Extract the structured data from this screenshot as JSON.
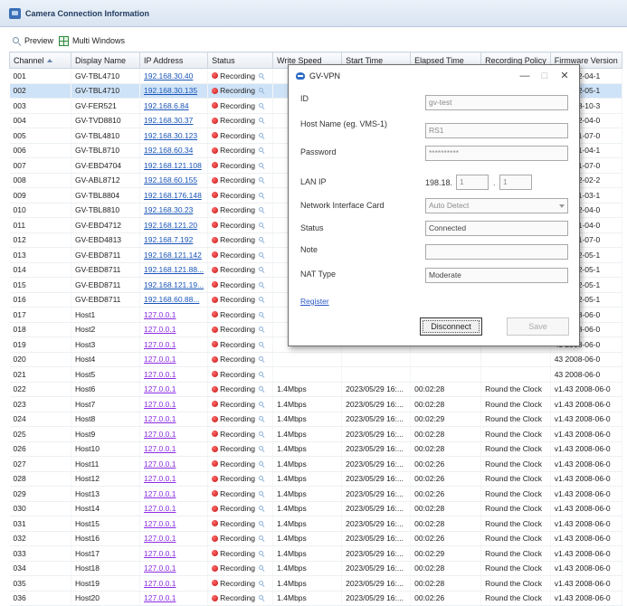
{
  "window": {
    "title": "Camera Connection Information",
    "accent": "#3a6fb7"
  },
  "toolbar": {
    "preview_label": "Preview",
    "multi_windows_label": "Multi Windows"
  },
  "table": {
    "columns": [
      "Channel",
      "Display Name",
      "IP Address",
      "Status",
      "Write Speed",
      "Start Time",
      "Elapsed Time",
      "Recording Policy",
      "Firmware Version"
    ],
    "rows": [
      {
        "ch": "001",
        "name": "GV-TBL4710",
        "ip": "192.168.30.40",
        "status": "Recording",
        "speed": "",
        "start": "",
        "elapsed": "",
        "policy": "",
        "fw": "05 2022-04-1"
      },
      {
        "ch": "002",
        "name": "GV-TBL4710",
        "ip": "192.168.30.135",
        "status": "Recording",
        "speed": "",
        "start": "",
        "elapsed": "",
        "policy": "",
        "fw": "07 2022-05-1"
      },
      {
        "ch": "003",
        "name": "GV-FER521",
        "ip": "192.168.6.84",
        "status": "Recording",
        "speed": "",
        "start": "",
        "elapsed": "",
        "policy": "",
        "fw": "17 2018-10-3"
      },
      {
        "ch": "004",
        "name": "GV-TVD8810",
        "ip": "192.168.30.37",
        "status": "Recording",
        "speed": "",
        "start": "",
        "elapsed": "",
        "policy": "",
        "fw": "05 2022-04-0"
      },
      {
        "ch": "005",
        "name": "GV-TBL4810",
        "ip": "192.168.30.123",
        "status": "Recording",
        "speed": "",
        "start": "",
        "elapsed": "",
        "policy": "",
        "fw": "00 2021-07-0"
      },
      {
        "ch": "006",
        "name": "GV-TBL8710",
        "ip": "192.168.60.34",
        "status": "Recording",
        "speed": "",
        "start": "",
        "elapsed": "",
        "policy": "",
        "fw": "04 2021-04-1"
      },
      {
        "ch": "007",
        "name": "GV-EBD4704",
        "ip": "192.168.121.108",
        "status": "Recording",
        "speed": "",
        "start": "",
        "elapsed": "",
        "policy": "",
        "fw": "00 2021-07-0"
      },
      {
        "ch": "008",
        "name": "GV-ABL8712",
        "ip": "192.168.60.155",
        "status": "Recording",
        "speed": "",
        "start": "",
        "elapsed": "",
        "policy": "",
        "fw": "05 2022-02-2"
      },
      {
        "ch": "009",
        "name": "GV-TBL8804",
        "ip": "192.168.176.148",
        "status": "Recording",
        "speed": "",
        "start": "",
        "elapsed": "",
        "policy": "",
        "fw": "01 2021-03-1"
      },
      {
        "ch": "010",
        "name": "GV-TBL8810",
        "ip": "192.168.30.23",
        "status": "Recording",
        "speed": "",
        "start": "",
        "elapsed": "",
        "policy": "",
        "fw": "05 2022-04-0"
      },
      {
        "ch": "011",
        "name": "GV-EBD4712",
        "ip": "192.168.121.20",
        "status": "Recording",
        "speed": "",
        "start": "",
        "elapsed": "",
        "policy": "",
        "fw": "02 2021-04-0"
      },
      {
        "ch": "012",
        "name": "GV-EBD4813",
        "ip": "192.168.7.192",
        "status": "Recording",
        "speed": "",
        "start": "",
        "elapsed": "",
        "policy": "",
        "fw": "00 2021-07-0"
      },
      {
        "ch": "013",
        "name": "GV-EBD8711",
        "ip": "192.168.121.142",
        "status": "Recording",
        "speed": "",
        "start": "",
        "elapsed": "",
        "policy": "",
        "fw": "06 2022-05-1"
      },
      {
        "ch": "014",
        "name": "GV-EBD8711",
        "ip": "192.168.121.88...",
        "status": "Recording",
        "speed": "",
        "start": "",
        "elapsed": "",
        "policy": "",
        "fw": "06 2022-05-1"
      },
      {
        "ch": "015",
        "name": "GV-EBD8711",
        "ip": "192.168.121.19...",
        "status": "Recording",
        "speed": "",
        "start": "",
        "elapsed": "",
        "policy": "",
        "fw": "06 2022-05-1"
      },
      {
        "ch": "016",
        "name": "GV-EBD8711",
        "ip": "192.168.60.88...",
        "status": "Recording",
        "speed": "",
        "start": "",
        "elapsed": "",
        "policy": "",
        "fw": "06 2022-05-1"
      },
      {
        "ch": "017",
        "name": "Host1",
        "ip": "127.0.0.1",
        "status": "Recording",
        "speed": "",
        "start": "",
        "elapsed": "",
        "policy": "",
        "fw": "43 2008-06-0"
      },
      {
        "ch": "018",
        "name": "Host2",
        "ip": "127.0.0.1",
        "status": "Recording",
        "speed": "",
        "start": "",
        "elapsed": "",
        "policy": "",
        "fw": "43 2008-06-0"
      },
      {
        "ch": "019",
        "name": "Host3",
        "ip": "127.0.0.1",
        "status": "Recording",
        "speed": "",
        "start": "",
        "elapsed": "",
        "policy": "",
        "fw": "43 2008-06-0"
      },
      {
        "ch": "020",
        "name": "Host4",
        "ip": "127.0.0.1",
        "status": "Recording",
        "speed": "",
        "start": "",
        "elapsed": "",
        "policy": "",
        "fw": "43 2008-06-0"
      },
      {
        "ch": "021",
        "name": "Host5",
        "ip": "127.0.0.1",
        "status": "Recording",
        "speed": "",
        "start": "",
        "elapsed": "",
        "policy": "",
        "fw": "43 2008-06-0"
      },
      {
        "ch": "022",
        "name": "Host6",
        "ip": "127.0.0.1",
        "status": "Recording",
        "speed": "1.4Mbps",
        "start": "2023/05/29 16:...",
        "elapsed": "00:02:28",
        "policy": "Round the Clock",
        "fw": "v1.43 2008-06-0"
      },
      {
        "ch": "023",
        "name": "Host7",
        "ip": "127.0.0.1",
        "status": "Recording",
        "speed": "1.4Mbps",
        "start": "2023/05/29 16:...",
        "elapsed": "00:02:28",
        "policy": "Round the Clock",
        "fw": "v1.43 2008-06-0"
      },
      {
        "ch": "024",
        "name": "Host8",
        "ip": "127.0.0.1",
        "status": "Recording",
        "speed": "1.4Mbps",
        "start": "2023/05/29 16:...",
        "elapsed": "00:02:29",
        "policy": "Round the Clock",
        "fw": "v1.43 2008-06-0"
      },
      {
        "ch": "025",
        "name": "Host9",
        "ip": "127.0.0.1",
        "status": "Recording",
        "speed": "1.4Mbps",
        "start": "2023/05/29 16:...",
        "elapsed": "00:02:28",
        "policy": "Round the Clock",
        "fw": "v1.43 2008-06-0"
      },
      {
        "ch": "026",
        "name": "Host10",
        "ip": "127.0.0.1",
        "status": "Recording",
        "speed": "1.4Mbps",
        "start": "2023/05/29 16:...",
        "elapsed": "00:02:28",
        "policy": "Round the Clock",
        "fw": "v1.43 2008-06-0"
      },
      {
        "ch": "027",
        "name": "Host11",
        "ip": "127.0.0.1",
        "status": "Recording",
        "speed": "1.4Mbps",
        "start": "2023/05/29 16:...",
        "elapsed": "00:02:26",
        "policy": "Round the Clock",
        "fw": "v1.43 2008-06-0"
      },
      {
        "ch": "028",
        "name": "Host12",
        "ip": "127.0.0.1",
        "status": "Recording",
        "speed": "1.4Mbps",
        "start": "2023/05/29 16:...",
        "elapsed": "00:02:26",
        "policy": "Round the Clock",
        "fw": "v1.43 2008-06-0"
      },
      {
        "ch": "029",
        "name": "Host13",
        "ip": "127.0.0.1",
        "status": "Recording",
        "speed": "1.4Mbps",
        "start": "2023/05/29 16:...",
        "elapsed": "00:02:26",
        "policy": "Round the Clock",
        "fw": "v1.43 2008-06-0"
      },
      {
        "ch": "030",
        "name": "Host14",
        "ip": "127.0.0.1",
        "status": "Recording",
        "speed": "1.4Mbps",
        "start": "2023/05/29 16:...",
        "elapsed": "00:02:28",
        "policy": "Round the Clock",
        "fw": "v1.43 2008-06-0"
      },
      {
        "ch": "031",
        "name": "Host15",
        "ip": "127.0.0.1",
        "status": "Recording",
        "speed": "1.4Mbps",
        "start": "2023/05/29 16:...",
        "elapsed": "00:02:28",
        "policy": "Round the Clock",
        "fw": "v1.43 2008-06-0"
      },
      {
        "ch": "032",
        "name": "Host16",
        "ip": "127.0.0.1",
        "status": "Recording",
        "speed": "1.4Mbps",
        "start": "2023/05/29 16:...",
        "elapsed": "00:02:26",
        "policy": "Round the Clock",
        "fw": "v1.43 2008-06-0"
      },
      {
        "ch": "033",
        "name": "Host17",
        "ip": "127.0.0.1",
        "status": "Recording",
        "speed": "1.4Mbps",
        "start": "2023/05/29 16:...",
        "elapsed": "00:02:29",
        "policy": "Round the Clock",
        "fw": "v1.43 2008-06-0"
      },
      {
        "ch": "034",
        "name": "Host18",
        "ip": "127.0.0.1",
        "status": "Recording",
        "speed": "1.4Mbps",
        "start": "2023/05/29 16:...",
        "elapsed": "00:02:28",
        "policy": "Round the Clock",
        "fw": "v1.43 2008-06-0"
      },
      {
        "ch": "035",
        "name": "Host19",
        "ip": "127.0.0.1",
        "status": "Recording",
        "speed": "1.4Mbps",
        "start": "2023/05/29 16:...",
        "elapsed": "00:02:28",
        "policy": "Round the Clock",
        "fw": "v1.43 2008-06-0"
      },
      {
        "ch": "036",
        "name": "Host20",
        "ip": "127.0.0.1",
        "status": "Recording",
        "speed": "1.4Mbps",
        "start": "2023/05/29 16:...",
        "elapsed": "00:02:26",
        "policy": "Round the Clock",
        "fw": "v1.43 2008-06-0"
      }
    ]
  },
  "dialog": {
    "title": "GV-VPN",
    "minimize": "—",
    "maximize": "□",
    "close": "✕",
    "id_label": "ID",
    "id_value": "gv-test",
    "host_label": "Host Name (eg. VMS-1)",
    "host_value": "RS1",
    "password_label": "Password",
    "password_value": "**********",
    "lan_ip_label": "LAN IP",
    "lan_ip_prefix": "198.18.",
    "lan_ip_octet3": "1",
    "lan_ip_octet4": "1",
    "nic_label": "Network Interface Card",
    "nic_value": "Auto Detect",
    "status_label": "Status",
    "status_value": "Connected",
    "note_label": "Note",
    "note_value": "",
    "nat_label": "NAT Type",
    "nat_value": "Moderate",
    "register_link": "Register",
    "disconnect_button": "Disconnect",
    "save_button": "Save"
  }
}
